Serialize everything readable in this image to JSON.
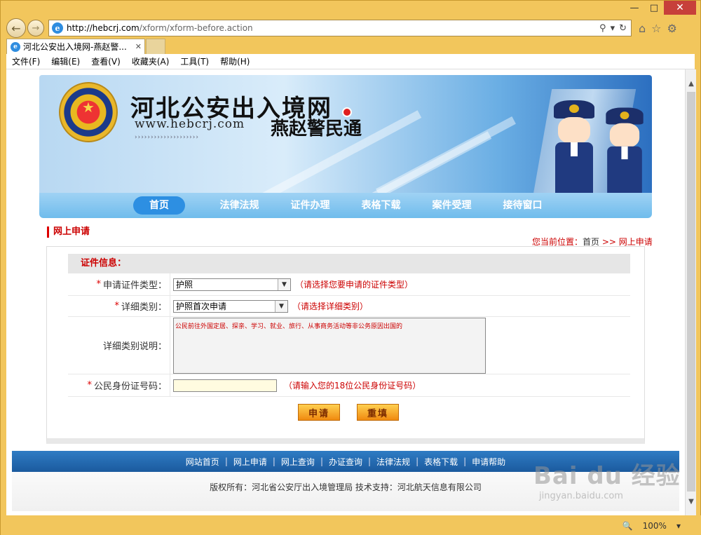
{
  "browser": {
    "url_host": "http://hebcrj.com",
    "url_path": "/xform/xform-before.action",
    "tab_title": "河北公安出入境网-燕赵警...",
    "menu": [
      "文件(F)",
      "编辑(E)",
      "查看(V)",
      "收藏夹(A)",
      "工具(T)",
      "帮助(H)"
    ],
    "zoom": "100%",
    "icons": {
      "back": "back-arrow-icon",
      "forward": "forward-arrow-icon",
      "home": "home-icon",
      "favorites": "star-icon",
      "settings": "gear-icon"
    }
  },
  "banner": {
    "title": "河北公安出入境网",
    "url": "www.hebcrj.com",
    "slogan": "燕赵警民通"
  },
  "mainnav": [
    "首页",
    "法律法规",
    "证件办理",
    "表格下载",
    "案件受理",
    "接待窗口"
  ],
  "section": {
    "title": "网上申请",
    "breadcrumb_prefix": "您当前位置：",
    "breadcrumb_home": "首页",
    "breadcrumb_rest": " >> 网上申请"
  },
  "form": {
    "header": "证件信息：",
    "required_mark": "*",
    "cert_type_label": "申请证件类型：",
    "cert_type_value": "护照",
    "cert_type_hint": "（请选择您要申请的证件类型）",
    "detail_label": "详细类别：",
    "detail_value": "护照首次申请",
    "detail_hint": "（请选择详细类别）",
    "desc_label": "详细类别说明：",
    "desc_text": "公民前往外国定居、探亲、学习、就业、旅行、从事商务活动等非公务原因出国的",
    "id_label": "公民身份证号码：",
    "id_value": "",
    "id_hint": "（请输入您的18位公民身份证号码）",
    "apply_button": "申请",
    "reset_button": "重填"
  },
  "footer": {
    "links": [
      "网站首页",
      "网上申请",
      "网上查询",
      "办证查询",
      "法律法规",
      "表格下载",
      "申请帮助"
    ],
    "separator": "|",
    "copyright": "版权所有：河北省公安厅出入境管理局 技术支持：河北航天信息有限公司"
  },
  "watermark": {
    "logo": "Bai du 经验",
    "url": "jingyan.baidu.com"
  }
}
